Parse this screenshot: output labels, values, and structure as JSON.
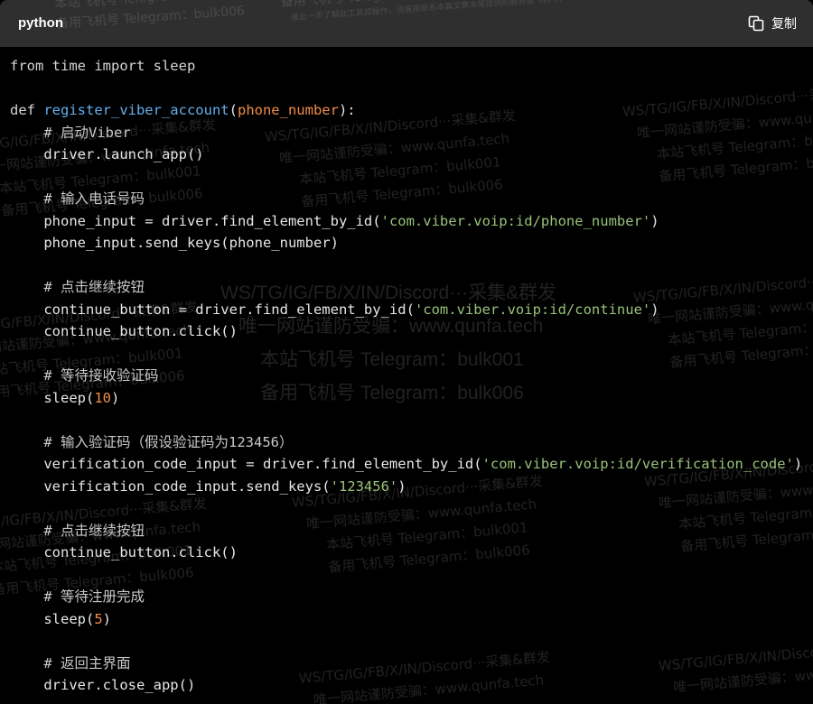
{
  "header": {
    "language": "python",
    "copy_label": "复制"
  },
  "code_lines": [
    "from time import sleep",
    "",
    "def register_viber_account(phone_number):",
    "    # 启动Viber",
    "    driver.launch_app()",
    "",
    "    # 输入电话号码",
    "    phone_input = driver.find_element_by_id('com.viber.voip:id/phone_number')",
    "    phone_input.send_keys(phone_number)",
    "",
    "    # 点击继续按钮",
    "    continue_button = driver.find_element_by_id('com.viber.voip:id/continue')",
    "    continue_button.click()",
    "",
    "    # 等待接收验证码",
    "    sleep(10)",
    "",
    "    # 输入验证码（假设验证码为123456）",
    "    verification_code_input = driver.find_element_by_id('com.viber.voip:id/verification_code')",
    "    verification_code_input.send_keys('123456')",
    "",
    "    # 点击继续按钮",
    "    continue_button.click()",
    "",
    "    # 等待注册完成",
    "    sleep(5)",
    "",
    "    # 返回主界面",
    "    driver.close_app()"
  ],
  "watermark": {
    "line1": "WS/TG/IG/FB/X/IN/Discord···采集&群发",
    "line2": "唯一网站谨防受骗：www.qunfa.tech",
    "line3": "本站飞机号 Telegram：bulk001",
    "line4": "备用飞机号 Telegram：bulk006",
    "line5": "彼此一步了解此工具成操作，请直接联系本篇文章末尾提供的服务客飞机号！"
  },
  "colors": {
    "background": "#000000",
    "header": "#2f2f2f",
    "function_name": "#61afef",
    "parameter": "#f08d49",
    "string": "#98c379",
    "number": "#f08d49"
  },
  "icons": {
    "copy": "copy-icon"
  }
}
